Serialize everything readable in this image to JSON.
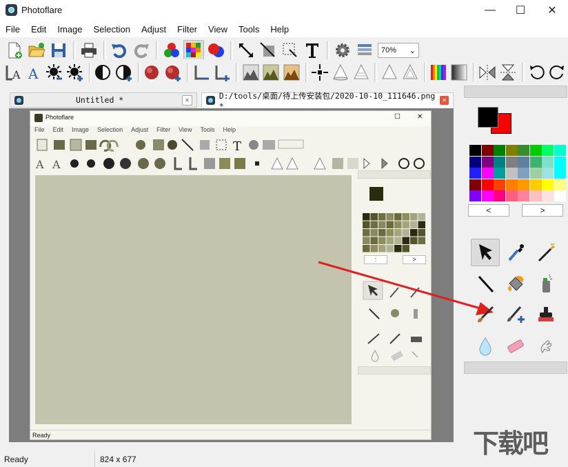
{
  "window": {
    "title": "Photoflare",
    "minimize": "—",
    "maximize": "☐",
    "close": "✕"
  },
  "menu": [
    "File",
    "Edit",
    "Image",
    "Selection",
    "Adjust",
    "Filter",
    "View",
    "Tools",
    "Help"
  ],
  "toolbar": {
    "zoom_value": "70%"
  },
  "tabs": [
    {
      "label": "Untitled *",
      "close": "✕"
    },
    {
      "label": "D:/tools/桌面/待上传安装包/2020-10-10_111646.png *",
      "close": "✕"
    }
  ],
  "inner_window": {
    "title": "Photoflare",
    "menu": [
      "File",
      "Edit",
      "Image",
      "Selection",
      "Adjust",
      "Filter",
      "View",
      "Tools",
      "Help"
    ],
    "status": "Ready",
    "nav_prev": ":",
    "nav_next": ">"
  },
  "palette": {
    "primary_color": "#000000",
    "secondary_color": "#ff0000",
    "prev_label": "<",
    "next_label": ">",
    "swatches": [
      "#000000",
      "#800000",
      "#008000",
      "#808000",
      "#3b8a2e",
      "#00cc00",
      "#00ff66",
      "#00ffcc",
      "#000080",
      "#800080",
      "#008080",
      "#7f7f7f",
      "#5f7f9f",
      "#3cb371",
      "#7ce1c8",
      "#00ffff",
      "#2020ff",
      "#ff00ff",
      "#00a0a0",
      "#c0c0c0",
      "#7fa0c0",
      "#9cd0a0",
      "#a0e0e0",
      "#00ffff",
      "#800000",
      "#ff0000",
      "#ff4000",
      "#ff8000",
      "#ff9900",
      "#ffcc00",
      "#ffff00",
      "#ffff80",
      "#8000ff",
      "#ff00ff",
      "#ff0080",
      "#ff6080",
      "#ff80a0",
      "#ffc0c0",
      "#ffe0e0",
      "#ffffff"
    ]
  },
  "status": {
    "text": "Ready",
    "size": "824 x 677"
  },
  "watermark": "下载吧"
}
